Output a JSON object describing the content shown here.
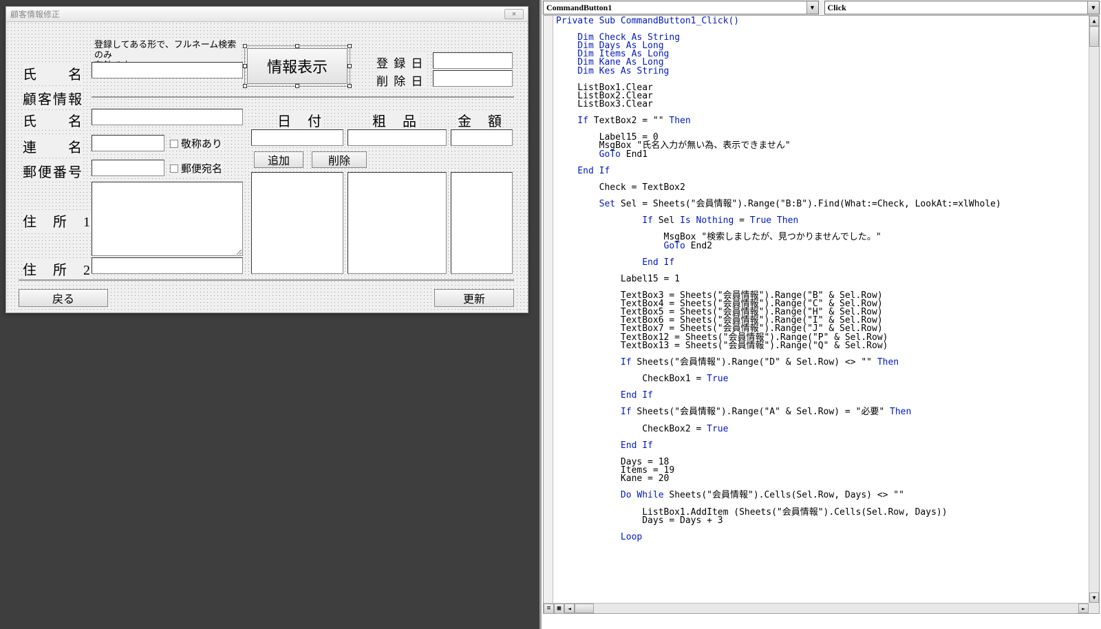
{
  "window": {
    "title": "顧客情報修正",
    "close": "✕"
  },
  "form": {
    "hint": "登録してある形で、フルネーム検索のみ\n有効です。",
    "labels": {
      "name1": "氏　　名",
      "group": "顧客情報",
      "name2": "氏　　名",
      "joint": "連　　名",
      "postal": "郵便番号",
      "addr1": "住　所　1",
      "addr2": "住　所　2",
      "regdate": "登 録 日",
      "deldate": "削 除 日",
      "date": "日　付",
      "item": "粗　品",
      "amount": "金　額"
    },
    "buttons": {
      "show": "情報表示",
      "add": "追加",
      "delete": "削除",
      "back": "戻る",
      "update": "更新"
    },
    "checkboxes": {
      "honorific": "敬称あり",
      "postalname": "郵便宛名"
    }
  },
  "editor": {
    "object_combo": "CommandButton1",
    "proc_combo": "Click"
  },
  "code": {
    "l1": "Private Sub CommandButton1_Click()",
    "l2": "",
    "l3a": "    Dim Check ",
    "l3b": "As String",
    "l4a": "    Dim Days ",
    "l4b": "As Long",
    "l5a": "    Dim Items ",
    "l5b": "As Long",
    "l6a": "    Dim Kane ",
    "l6b": "As Long",
    "l7a": "    Dim Kes ",
    "l7b": "As String",
    "l8": "",
    "l9": "    ListBox1.Clear",
    "l10": "    ListBox2.Clear",
    "l11": "    ListBox3.Clear",
    "l12": "",
    "l13a": "    If",
    "l13b": " TextBox2 = \"\" ",
    "l13c": "Then",
    "l14": "",
    "l15": "        Label15 = 0",
    "l16": "        MsgBox \"氏名入力が無い為、表示できません\"",
    "l17a": "        GoTo",
    "l17b": " End1",
    "l18": "",
    "l19": "    End If",
    "l20": "",
    "l21": "        Check = TextBox2",
    "l22": "",
    "l23a": "        Set",
    "l23b": " Sel = Sheets(\"会員情報\").Range(\"B:B\").Find(What:=Check, LookAt:=xlWhole)",
    "l24": "",
    "l25a": "                If",
    "l25b": " Sel ",
    "l25c": "Is Nothing",
    "l25d": " = ",
    "l25e": "True Then",
    "l26": "",
    "l27": "                    MsgBox \"検索しましたが、見つかりませんでした。\"",
    "l28a": "                    GoTo",
    "l28b": " End2",
    "l29": "",
    "l30": "                End If",
    "l31": "",
    "l32": "            Label15 = 1",
    "l33": "",
    "l34": "            TextBox3 = Sheets(\"会員情報\").Range(\"B\" & Sel.Row)",
    "l35": "            TextBox4 = Sheets(\"会員情報\").Range(\"C\" & Sel.Row)",
    "l36": "            TextBox5 = Sheets(\"会員情報\").Range(\"H\" & Sel.Row)",
    "l37": "            TextBox6 = Sheets(\"会員情報\").Range(\"I\" & Sel.Row)",
    "l38": "            TextBox7 = Sheets(\"会員情報\").Range(\"J\" & Sel.Row)",
    "l39": "            TextBox12 = Sheets(\"会員情報\").Range(\"P\" & Sel.Row)",
    "l40": "            TextBox13 = Sheets(\"会員情報\").Range(\"Q\" & Sel.Row)",
    "l41": "",
    "l42a": "            If",
    "l42b": " Sheets(\"会員情報\").Range(\"D\" & Sel.Row) <> \"\" ",
    "l42c": "Then",
    "l43": "",
    "l44a": "                CheckBox1 = ",
    "l44b": "True",
    "l45": "",
    "l46": "            End If",
    "l47": "",
    "l48a": "            If",
    "l48b": " Sheets(\"会員情報\").Range(\"A\" & Sel.Row) = \"必要\" ",
    "l48c": "Then",
    "l49": "",
    "l50a": "                CheckBox2 = ",
    "l50b": "True",
    "l51": "",
    "l52": "            End If",
    "l53": "            ",
    "l54": "            Days = 18",
    "l55": "            Items = 19",
    "l56": "            Kane = 20",
    "l57": "",
    "l58a": "            Do While",
    "l58b": " Sheets(\"会員情報\").Cells(Sel.Row, Days) <> \"\"",
    "l59": "",
    "l60": "                ListBox1.AddItem (Sheets(\"会員情報\").Cells(Sel.Row, Days))",
    "l61": "                Days = Days + 3",
    "l62": "",
    "l63": "            Loop"
  }
}
